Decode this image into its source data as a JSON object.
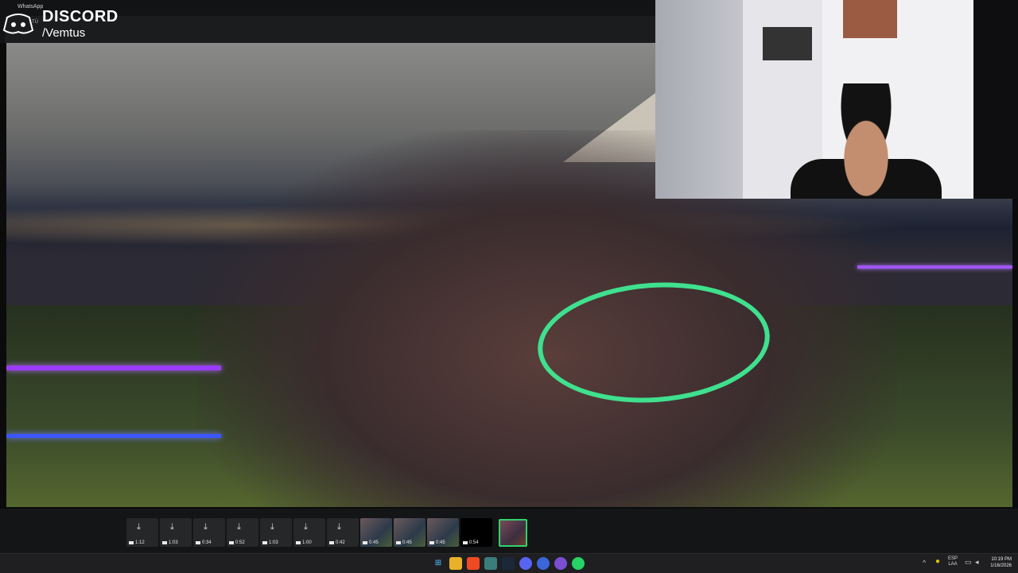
{
  "overlay": {
    "whatsapp_label": "WhatsApp",
    "tu_label": "TÚ",
    "brand": "DISCORD",
    "handle": "/Vemtus"
  },
  "thumbnails": [
    {
      "type": "video",
      "duration": "1:12"
    },
    {
      "type": "video",
      "duration": "1:03"
    },
    {
      "type": "video",
      "duration": "0:34"
    },
    {
      "type": "video",
      "duration": "0:52"
    },
    {
      "type": "video",
      "duration": "1:03"
    },
    {
      "type": "video",
      "duration": "1:00"
    },
    {
      "type": "video",
      "duration": "0:42"
    },
    {
      "type": "image-video",
      "duration": "0:45"
    },
    {
      "type": "image-video",
      "duration": "0:45"
    },
    {
      "type": "image-video",
      "duration": "0:45"
    },
    {
      "type": "black-video",
      "duration": "0:54"
    },
    {
      "type": "selected-image",
      "duration": ""
    }
  ],
  "taskbar": {
    "apps": [
      "windows-start",
      "file-explorer",
      "brave-browser",
      "terminal",
      "steam",
      "discord",
      "app",
      "app-2",
      "whatsapp"
    ],
    "lang_top": "ESP",
    "lang_bottom": "LAA",
    "time": "10:19 PM",
    "date": "1/16/2026"
  },
  "colors": {
    "highlight_circle": "#3fe08e",
    "selected_thumb_border": "#2fd36a"
  }
}
